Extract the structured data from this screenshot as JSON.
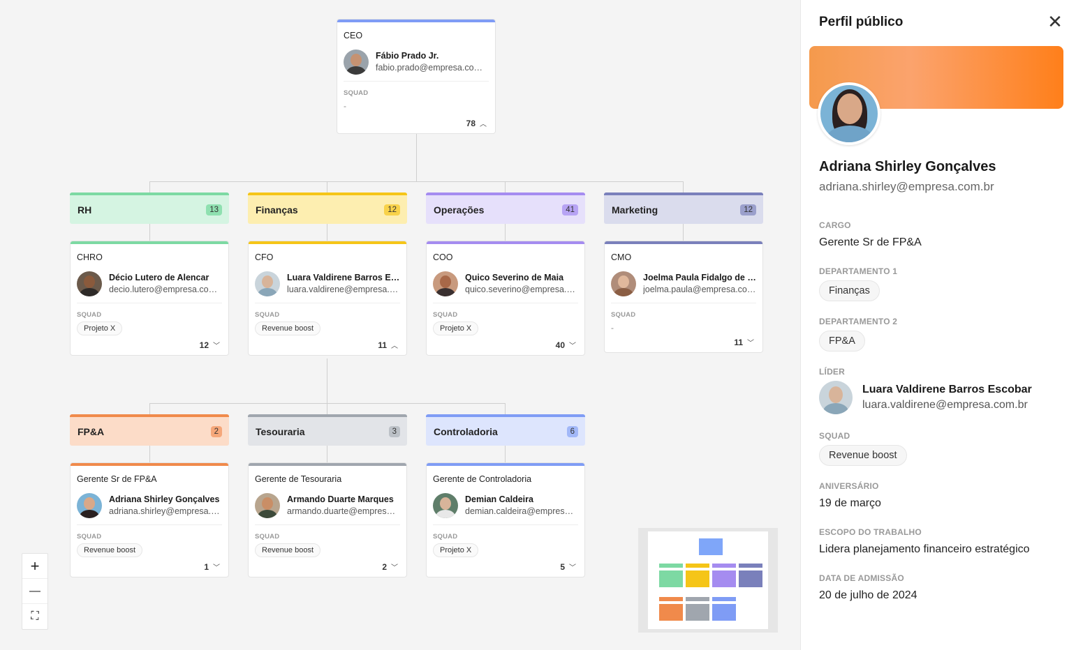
{
  "ceo": {
    "role": "CEO",
    "name": "Fábio Prado Jr.",
    "email": "fabio.prado@empresa.com.br",
    "squad_label": "SQUAD",
    "squad": "-",
    "count": "78",
    "chevron": "up"
  },
  "departments": [
    {
      "name": "RH",
      "count": "13",
      "color": "#7dd9a3",
      "bg": "#d5f4e2",
      "badge": "#8fe0b0"
    },
    {
      "name": "Finanças",
      "count": "12",
      "color": "#f5c518",
      "bg": "#fdeeb0",
      "badge": "#f8d24a"
    },
    {
      "name": "Operações",
      "count": "41",
      "color": "#a58cf0",
      "bg": "#e6e0fb",
      "badge": "#b7a4f4"
    },
    {
      "name": "Marketing",
      "count": "12",
      "color": "#7a80bb",
      "bg": "#dadced",
      "badge": "#9ba0cc"
    }
  ],
  "leaders": [
    {
      "role": "CHRO",
      "name": "Décio Lutero de Alencar",
      "email": "decio.lutero@empresa.com.br",
      "squad_label": "SQUAD",
      "squad": "Projeto X",
      "count": "12",
      "chevron": "down"
    },
    {
      "role": "CFO",
      "name": "Luara Valdirene Barros Escobar",
      "email": "luara.valdirene@empresa.com.br",
      "squad_label": "SQUAD",
      "squad": "Revenue boost",
      "count": "11",
      "chevron": "up"
    },
    {
      "role": "COO",
      "name": "Quico Severino de Maia",
      "email": "quico.severino@empresa.com.br",
      "squad_label": "SQUAD",
      "squad": "Projeto X",
      "count": "40",
      "chevron": "down"
    },
    {
      "role": "CMO",
      "name": "Joelma Paula Fidalgo de Souza",
      "email": "joelma.paula@empresa.com.br",
      "squad_label": "SQUAD",
      "squad": "-",
      "count": "11",
      "chevron": "down"
    }
  ],
  "subdepartments": [
    {
      "name": "FP&A",
      "count": "2",
      "color": "#f08a4b",
      "bg": "#fcdcc8",
      "badge": "#f5a77a"
    },
    {
      "name": "Tesouraria",
      "count": "3",
      "color": "#a0a6ae",
      "bg": "#e2e4e8",
      "badge": "#bcc1c7"
    },
    {
      "name": "Controladoria",
      "count": "6",
      "color": "#7f9cf5",
      "bg": "#dde5fd",
      "badge": "#a2b8f8"
    }
  ],
  "managers": [
    {
      "role": "Gerente Sr de FP&A",
      "name": "Adriana Shirley Gonçalves",
      "email": "adriana.shirley@empresa.com.br",
      "squad_label": "SQUAD",
      "squad": "Revenue boost",
      "count": "1",
      "chevron": "down"
    },
    {
      "role": "Gerente de Tesouraria",
      "name": "Armando Duarte Marques",
      "email": "armando.duarte@empresa.com.br",
      "squad_label": "SQUAD",
      "squad": "Revenue boost",
      "count": "2",
      "chevron": "down"
    },
    {
      "role": "Gerente de Controladoria",
      "name": "Demian Caldeira",
      "email": "demian.caldeira@empresa.com.br",
      "squad_label": "SQUAD",
      "squad": "Projeto X",
      "count": "5",
      "chevron": "down"
    }
  ],
  "zoom": {
    "plus": "+",
    "minus": "—",
    "fit": "⛶"
  },
  "panel": {
    "title": "Perfil público",
    "close": "✕",
    "name": "Adriana Shirley Gonçalves",
    "email": "adriana.shirley@empresa.com.br",
    "cargo_label": "CARGO",
    "cargo": "Gerente Sr de FP&A",
    "dep1_label": "DEPARTAMENTO 1",
    "dep1": "Finanças",
    "dep2_label": "DEPARTAMENTO 2",
    "dep2": "FP&A",
    "lider_label": "LÍDER",
    "lider_name": "Luara Valdirene Barros Escobar",
    "lider_email": "luara.valdirene@empresa.com.br",
    "squad_label": "SQUAD",
    "squad": "Revenue boost",
    "aniversario_label": "ANIVERSÁRIO",
    "aniversario": "19 de março",
    "escopo_label": "ESCOPO DO TRABALHO",
    "escopo": "Lidera planejamento financeiro estratégico",
    "admissao_label": "DATA DE ADMISSÃO",
    "admissao": "20 de julho de 2024"
  }
}
